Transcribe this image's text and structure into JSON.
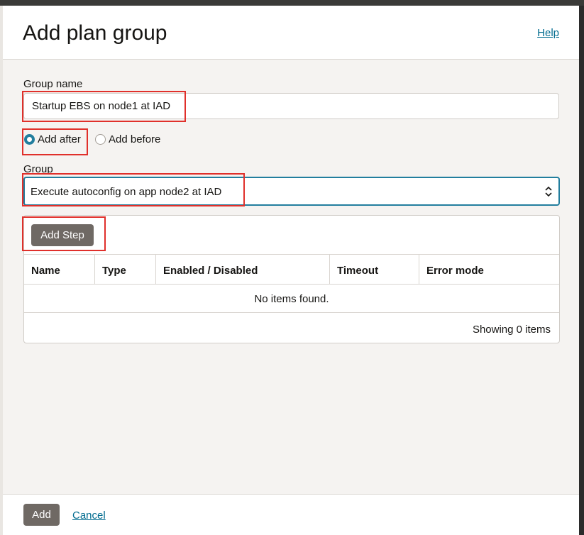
{
  "dialog": {
    "title": "Add plan group",
    "help_label": "Help"
  },
  "form": {
    "group_name_label": "Group name",
    "group_name_value": "Startup EBS on node1 at IAD",
    "radio_add_after": "Add after",
    "radio_add_before": "Add before",
    "selected_position": "Add after",
    "group_label": "Group",
    "group_selected": "Execute autoconfig on app node2 at IAD"
  },
  "steps_table": {
    "add_step_label": "Add Step",
    "columns": [
      "Name",
      "Type",
      "Enabled / Disabled",
      "Timeout",
      "Error mode"
    ],
    "empty_message": "No items found.",
    "showing_text": "Showing 0 items"
  },
  "footer": {
    "add_label": "Add",
    "cancel_label": "Cancel"
  },
  "colors": {
    "accent": "#227e9e",
    "link": "#006b8f",
    "button": "#6f6964",
    "annotation": "#e0302b"
  }
}
